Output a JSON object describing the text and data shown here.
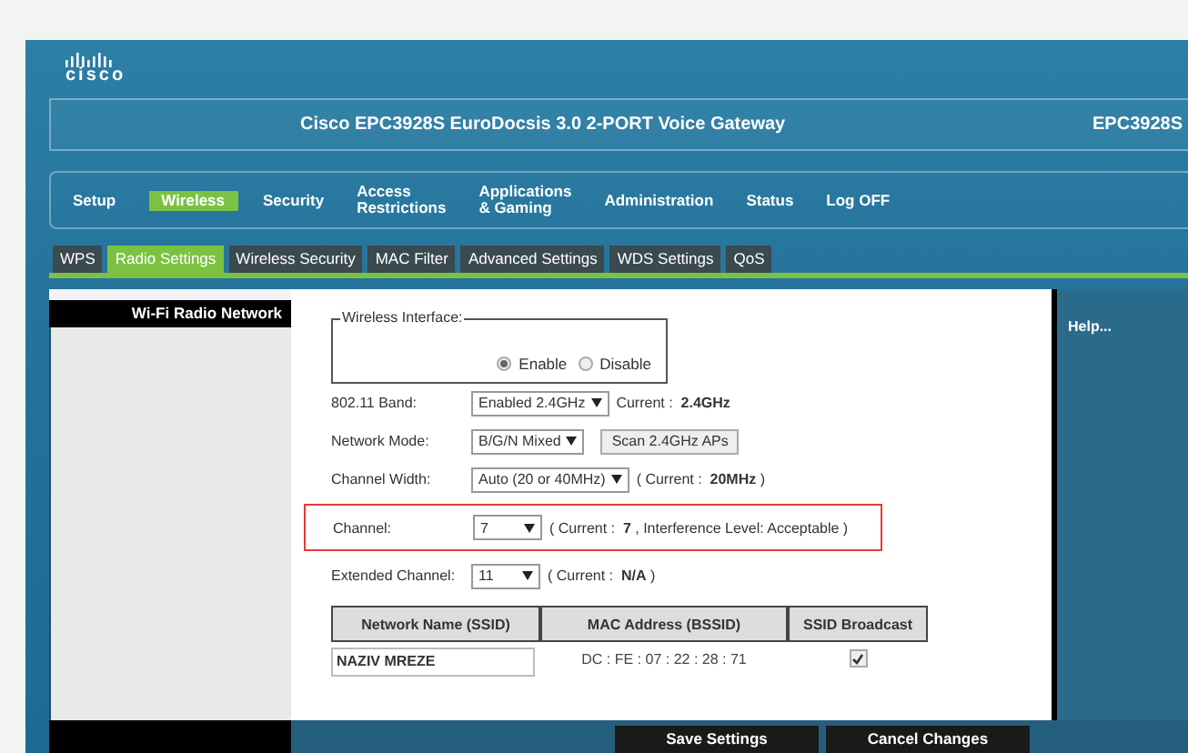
{
  "header": {
    "logo": "cisco",
    "title": "Cisco EPC3928S EuroDocsis 3.0 2-PORT Voice Gateway",
    "model": "EPC3928S"
  },
  "nav": [
    {
      "label": "Setup",
      "selected": false
    },
    {
      "label": "Wireless",
      "selected": true
    },
    {
      "label": "Security",
      "selected": false
    },
    {
      "label": "Access\nRestrictions",
      "selected": false
    },
    {
      "label": "Applications\n& Gaming",
      "selected": false
    },
    {
      "label": "Administration",
      "selected": false
    },
    {
      "label": "Status",
      "selected": false
    },
    {
      "label": "Log OFF",
      "selected": false
    }
  ],
  "subtabs": [
    {
      "label": "WPS",
      "selected": false
    },
    {
      "label": "Radio Settings",
      "selected": true
    },
    {
      "label": "Wireless Security",
      "selected": false
    },
    {
      "label": "MAC Filter",
      "selected": false
    },
    {
      "label": "Advanced Settings",
      "selected": false
    },
    {
      "label": "WDS Settings",
      "selected": false
    },
    {
      "label": "QoS",
      "selected": false
    }
  ],
  "sidebar": {
    "title": "Wi-Fi Radio Network"
  },
  "wireless_interface": {
    "legend": "Wireless Interface:",
    "options": [
      {
        "label": "Enable",
        "selected": true
      },
      {
        "label": "Disable",
        "selected": false
      }
    ]
  },
  "settings": [
    {
      "label": "802.11 Band:",
      "select": "Enabled 2.4GHz",
      "note": "Current :  **2.4GHz**",
      "highlighted": false
    },
    {
      "label": "Network Mode:",
      "select": "B/G/N Mixed",
      "button": "Scan 2.4GHz APs",
      "highlighted": false
    },
    {
      "label": "Channel Width:",
      "select": "Auto (20 or 40MHz)",
      "note": "( Current :  **20MHz** )",
      "highlighted": false
    },
    {
      "label": "Channel:",
      "select": "7",
      "note": "( Current :  **7** , Interference Level: Acceptable )",
      "highlighted": true
    },
    {
      "label": "Extended Channel:",
      "select": "11",
      "note": "( Current :  **N/A** )",
      "highlighted": false
    }
  ],
  "table": {
    "columns": [
      "Network Name (SSID)",
      "MAC Address (BSSID)",
      "SSID Broadcast"
    ],
    "rows": [
      {
        "ssid": "NAZIV MREZE",
        "mac": "DC : FE : 07 : 22 : 28 : 71",
        "broadcast": true
      }
    ]
  },
  "help": "Help...",
  "buttons": [
    "Save Settings",
    "Cancel Changes"
  ]
}
